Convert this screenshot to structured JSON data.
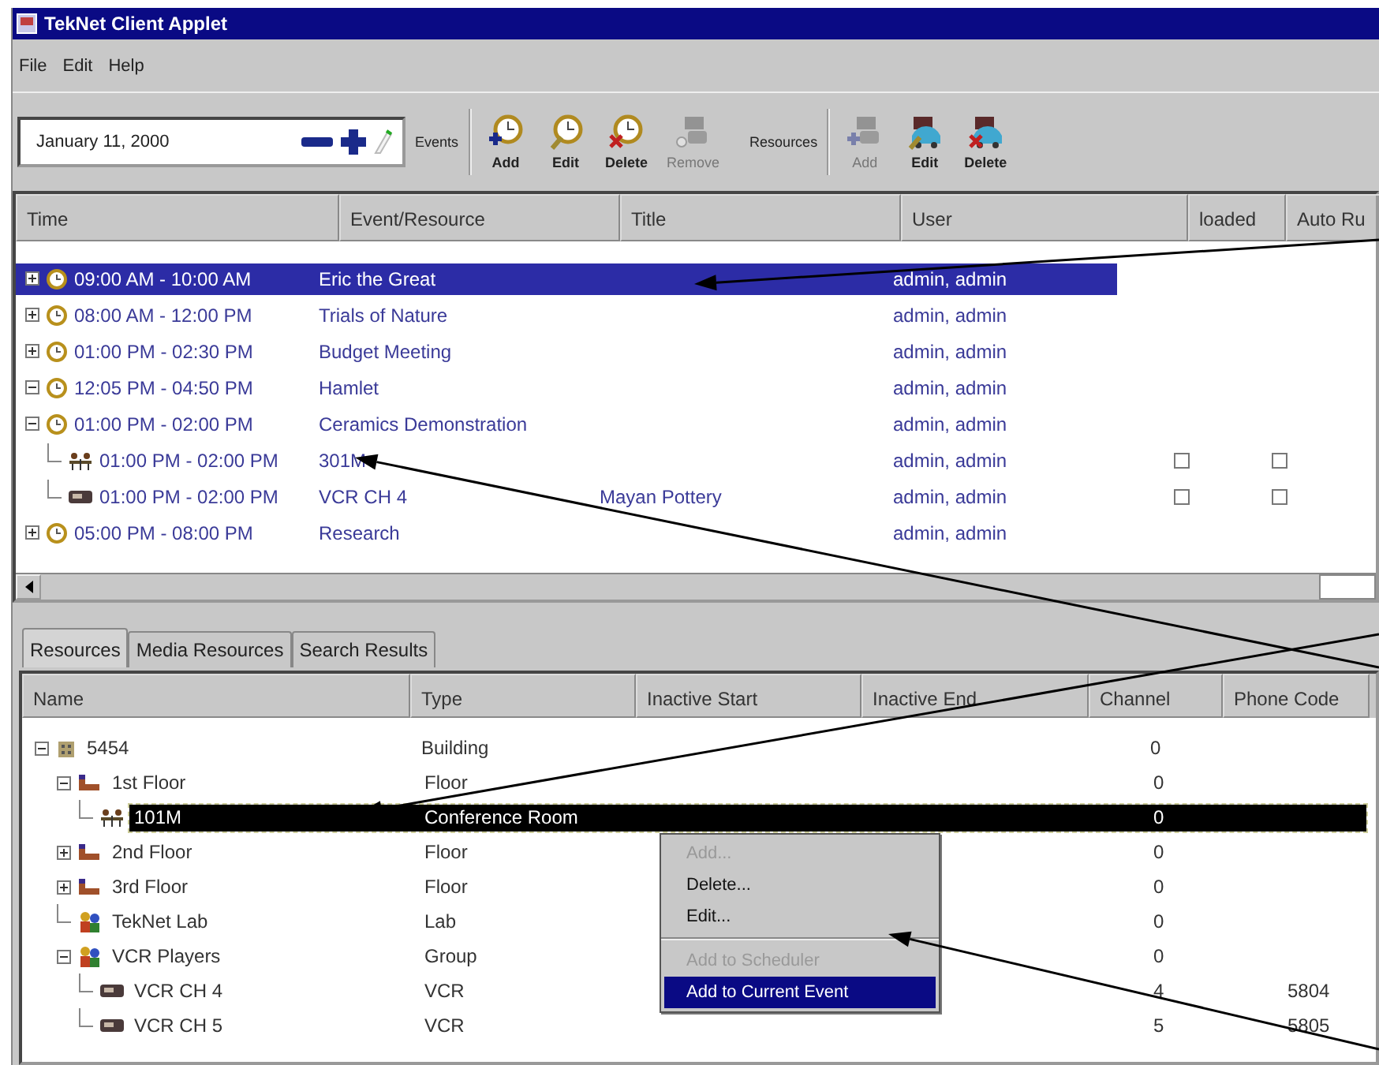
{
  "window": {
    "title": "TekNet Client Applet"
  },
  "menu": [
    "File",
    "Edit",
    "Help"
  ],
  "date_field": {
    "value": "January 11, 2000"
  },
  "toolbar": {
    "events_label": "Events",
    "event_buttons": [
      {
        "kind": "add",
        "label": "Add",
        "disabled": false
      },
      {
        "kind": "edit",
        "label": "Edit",
        "disabled": false
      },
      {
        "kind": "delete",
        "label": "Delete",
        "disabled": false
      },
      {
        "kind": "remove",
        "label": "Remove",
        "disabled": true
      }
    ],
    "resources_label": "Resources",
    "resource_buttons": [
      {
        "kind": "add",
        "label": "Add",
        "disabled": true
      },
      {
        "kind": "edit",
        "label": "Edit",
        "disabled": false
      },
      {
        "kind": "delete",
        "label": "Delete",
        "disabled": false
      }
    ]
  },
  "events_table": {
    "columns": [
      "Time",
      "Event/Resource",
      "Title",
      "User",
      "loaded",
      "Auto Ru"
    ],
    "rows": [
      {
        "kind": "event",
        "time": "09:00 AM - 10:00 AM",
        "name": "Eric the Great",
        "user": "admin, admin",
        "expanded": false,
        "selected": true
      },
      {
        "kind": "event",
        "time": "08:00 AM - 12:00 PM",
        "name": "Trials of Nature",
        "user": "admin, admin",
        "expanded": false,
        "selected": false
      },
      {
        "kind": "event",
        "time": "01:00 PM - 02:30 PM",
        "name": "Budget Meeting",
        "user": "admin, admin",
        "expanded": false,
        "selected": false
      },
      {
        "kind": "event",
        "time": "12:05 PM - 04:50 PM",
        "name": "Hamlet",
        "user": "admin, admin",
        "expanded": true,
        "selected": false
      },
      {
        "kind": "event",
        "time": "01:00 PM - 02:00 PM",
        "name": "Ceramics Demonstration",
        "user": "admin, admin",
        "expanded": true,
        "selected": false,
        "children": [
          {
            "kind": "room",
            "time": "01:00 PM - 02:00 PM",
            "name": "301M",
            "user": "admin, admin",
            "loaded": false,
            "auto_run": false,
            "selected": false
          },
          {
            "kind": "vcr",
            "time": "01:00 PM - 02:00 PM",
            "name": "VCR CH 4",
            "title": "Mayan Pottery",
            "user": "admin, admin",
            "loaded": false,
            "auto_run": false,
            "selected": false
          }
        ]
      },
      {
        "kind": "event",
        "time": "05:00 PM - 08:00 PM",
        "name": "Research",
        "user": "admin, admin",
        "expanded": false,
        "selected": false
      }
    ]
  },
  "tabs": [
    {
      "label": "Resources",
      "selected": true
    },
    {
      "label": "Media Resources",
      "selected": false
    },
    {
      "label": "Search Results",
      "selected": false
    }
  ],
  "resources_table": {
    "columns": [
      "Name",
      "Type",
      "Inactive Start",
      "Inactive End",
      "Channel",
      "Phone Code"
    ],
    "rows": [
      {
        "kind": "building",
        "name": "5454",
        "type": "Building",
        "channel": "0",
        "expanded": true,
        "selected": false,
        "children": [
          {
            "kind": "floor",
            "name": "1st Floor",
            "type": "Floor",
            "channel": "0",
            "expanded": true,
            "selected": false,
            "children": [
              {
                "kind": "room",
                "name": "101M",
                "type": "Conference Room",
                "channel": "0",
                "selected": true
              }
            ]
          },
          {
            "kind": "floor",
            "name": "2nd Floor",
            "type": "Floor",
            "channel": "0",
            "expanded": false,
            "selected": false
          },
          {
            "kind": "floor",
            "name": "3rd Floor",
            "type": "Floor",
            "channel": "0",
            "expanded": false,
            "selected": false
          },
          {
            "kind": "group",
            "name": "TekNet Lab",
            "type": "Lab",
            "channel": "0",
            "selected": false
          },
          {
            "kind": "group",
            "name": "VCR Players",
            "type": "Group",
            "channel": "0",
            "expanded": true,
            "selected": false,
            "children": [
              {
                "kind": "vcr",
                "name": "VCR CH 4",
                "type": "VCR",
                "channel": "4",
                "phone_code": "5804",
                "selected": false
              },
              {
                "kind": "vcr",
                "name": "VCR CH 5",
                "type": "VCR",
                "channel": "5",
                "phone_code": "5805",
                "selected": false
              }
            ]
          }
        ]
      }
    ]
  },
  "context_menu": [
    {
      "kind": "item",
      "label": "Add...",
      "disabled": true,
      "selected": false
    },
    {
      "kind": "item",
      "label": "Delete...",
      "disabled": false,
      "selected": false
    },
    {
      "kind": "item",
      "label": "Edit...",
      "disabled": false,
      "selected": false
    },
    {
      "kind": "separator"
    },
    {
      "kind": "item",
      "label": "Add to Scheduler",
      "disabled": true,
      "selected": false
    },
    {
      "kind": "item",
      "label": "Add to Current Event",
      "disabled": false,
      "selected": true
    }
  ]
}
